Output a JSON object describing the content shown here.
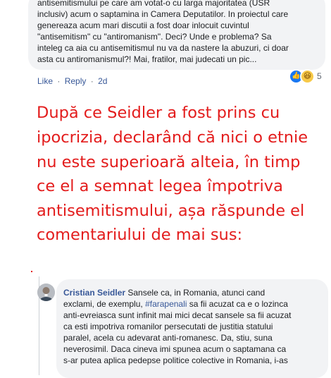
{
  "comment1": {
    "lines": [
      "antisemitismului pe care am votat-o cu larga majoritatea (USR",
      "inclusiv) acum o saptamina in Camera Deputatilor. In proiectul care",
      "genereaza acum mari discutii a fost doar inlocuit cuvintul",
      "\"antisemitism\" cu \"antiromanism\". Deci? Unde e problema? Sa",
      "inteleg ca aia cu antisemitismul nu va da nastere la abuzuri, ci doar",
      "asta cu antiromanismul?! Mai, fratilor, mai judecati un pic..."
    ],
    "actions": {
      "like": "Like",
      "reply": "Reply",
      "separator": "·",
      "time": "2d"
    },
    "reactions": {
      "count": "5",
      "types": [
        "like-icon",
        "haha-icon"
      ]
    }
  },
  "note": {
    "lines": [
      "După ce Seidler a fost prins cu",
      "ipocrizia, declarând că nici o etnie",
      "nu este superioară alteia, în timp",
      "ce el a semnat legea împotriva",
      "antisemitismului, așa răspunde el",
      "comentariului de mai sus:"
    ],
    "color": "#e31c1c"
  },
  "comment2": {
    "author": "Cristian Seidler",
    "line1_text": "Sansele ca, in Romania, atunci cand",
    "line2_before": "exclami, de exemplu, ",
    "hashtag": "#farapenali",
    "line2_after": " sa fii acuzat ca e o lozinca",
    "lines_rest": [
      "anti-evreiasca sunt infinit mai mici decat sansele sa fii acuzat",
      "ca esti impotriva romanilor persecutati de justitia statului",
      "paralel, acela cu adevarat anti-romanesc. Da, stiu, suna",
      "neverosimil. Daca cineva imi spunea acum o saptamana ca",
      "s-ar putea aplica pedepse politice colective in Romania, i-as"
    ]
  },
  "colors": {
    "bubble": "#f2f3f5",
    "link": "#385898",
    "meta": "#606770",
    "text": "#1c1e21"
  }
}
